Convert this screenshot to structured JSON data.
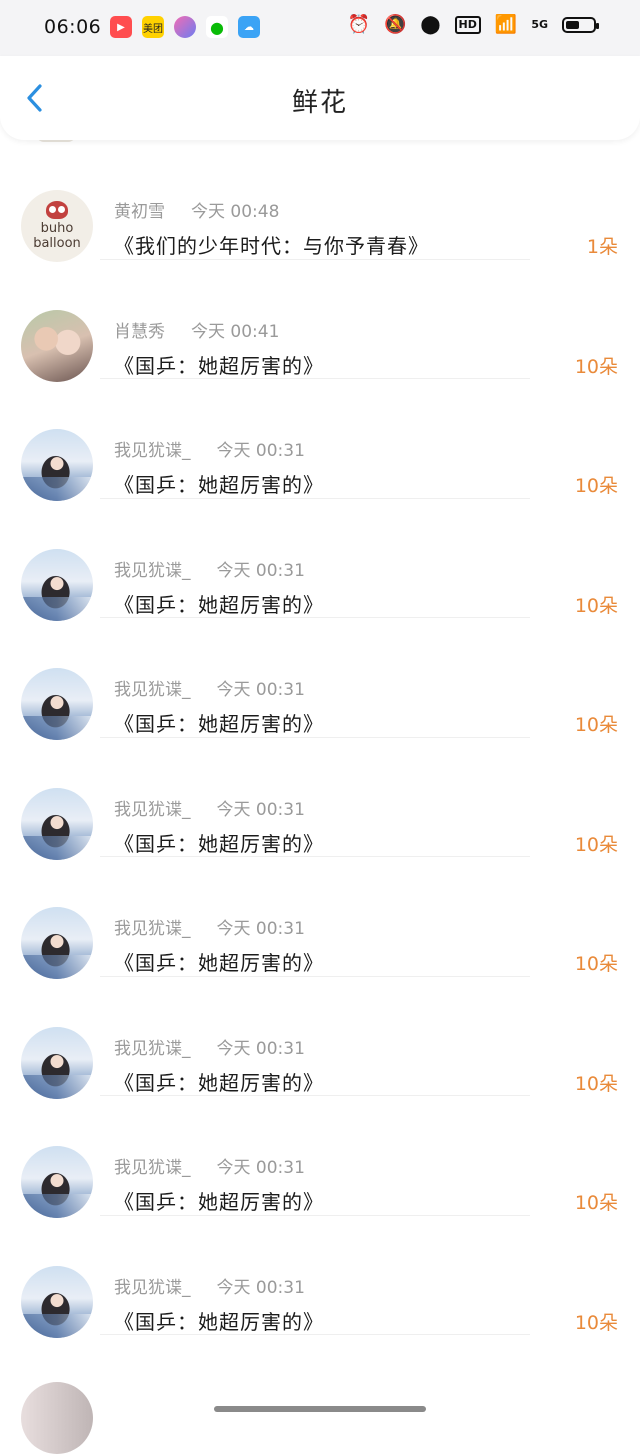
{
  "status_bar": {
    "time": "06:06",
    "app_icons": [
      {
        "name": "video-app-icon",
        "color": "#ff4d4f"
      },
      {
        "name": "meituan-app-icon",
        "label": "美团",
        "color": "#ffd100"
      },
      {
        "name": "ball-app-icon",
        "color": "#7a6cf0"
      },
      {
        "name": "wechat-app-icon",
        "color": "#09bb07"
      },
      {
        "name": "weather-app-icon",
        "color": "#3ba3f5"
      }
    ],
    "hd_label": "HD",
    "network_label": "5G",
    "battery_percent": 50
  },
  "header": {
    "title": "鲜花",
    "accent_color": "#2b8fe0"
  },
  "list": [
    {
      "avatar": "buho",
      "avatar_text": [
        "buho",
        "balloon"
      ],
      "name": "黄初雪",
      "time": "今天 00:48",
      "title": "《我们的少年时代：与你予青春》",
      "count": "1朵"
    },
    {
      "avatar": "photo2",
      "name": "肖慧秀",
      "time": "今天 00:41",
      "title": "《国乒：她超厉害的》",
      "count": "10朵"
    },
    {
      "avatar": "girl",
      "name": "我见犹谍_",
      "time": "今天 00:31",
      "title": "《国乒：她超厉害的》",
      "count": "10朵"
    },
    {
      "avatar": "girl",
      "name": "我见犹谍_",
      "time": "今天 00:31",
      "title": "《国乒：她超厉害的》",
      "count": "10朵"
    },
    {
      "avatar": "girl",
      "name": "我见犹谍_",
      "time": "今天 00:31",
      "title": "《国乒：她超厉害的》",
      "count": "10朵"
    },
    {
      "avatar": "girl",
      "name": "我见犹谍_",
      "time": "今天 00:31",
      "title": "《国乒：她超厉害的》",
      "count": "10朵"
    },
    {
      "avatar": "girl",
      "name": "我见犹谍_",
      "time": "今天 00:31",
      "title": "《国乒：她超厉害的》",
      "count": "10朵"
    },
    {
      "avatar": "girl",
      "name": "我见犹谍_",
      "time": "今天 00:31",
      "title": "《国乒：她超厉害的》",
      "count": "10朵"
    },
    {
      "avatar": "girl",
      "name": "我见犹谍_",
      "time": "今天 00:31",
      "title": "《国乒：她超厉害的》",
      "count": "10朵"
    },
    {
      "avatar": "girl",
      "name": "我见犹谍_",
      "time": "今天 00:31",
      "title": "《国乒：她超厉害的》",
      "count": "10朵"
    }
  ],
  "colors": {
    "count": "#e98a3a",
    "meta": "#9a9a9a"
  }
}
